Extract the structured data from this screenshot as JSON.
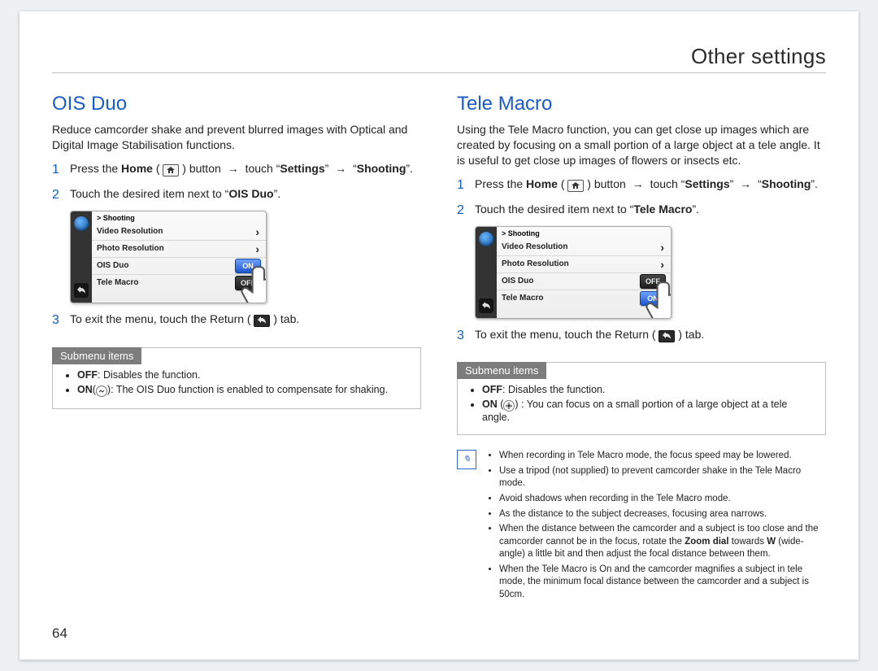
{
  "header": {
    "title": "Other settings"
  },
  "page_number": "64",
  "common": {
    "submenu_label": "Submenu items",
    "step1_prefix": "Press the ",
    "home": "Home",
    "button_word": " button ",
    "touch_word": " touch ",
    "settings": "Settings",
    "shooting": "Shooting",
    "step2_prefix": "Touch the desired item next to ",
    "step3": "To exit the menu, touch the Return (",
    "step3_tail": ") tab."
  },
  "ois": {
    "title": "OIS Duo",
    "blurb": "Reduce camcorder shake and prevent blurred images with Optical and Digital Image Stabilisation functions.",
    "item_name": "OIS Duo",
    "screenshot": {
      "crumb": "> Shooting",
      "items": [
        {
          "label": "Video Resolution",
          "right": "chev"
        },
        {
          "label": "Photo Resolution",
          "right": "chev"
        },
        {
          "label": "OIS Duo",
          "right": "on",
          "pill_on": "ON"
        },
        {
          "label": "Tele Macro",
          "right": "off",
          "pill_off": "OFF"
        }
      ]
    },
    "submenu": {
      "off_label": "OFF",
      "off_text": ": Disables the function.",
      "on_label": "ON",
      "on_text": ": The OIS Duo function is enabled to compensate for shaking."
    }
  },
  "tele": {
    "title": "Tele Macro",
    "blurb": "Using the Tele Macro function, you can get close up images which are created by focusing on a small portion of a large object at a tele angle. It is useful to get close up images of flowers or insects etc.",
    "item_name": "Tele Macro",
    "screenshot": {
      "crumb": "> Shooting",
      "items": [
        {
          "label": "Video Resolution",
          "right": "chev"
        },
        {
          "label": "Photo Resolution",
          "right": "chev"
        },
        {
          "label": "OIS Duo",
          "right": "off",
          "pill_off": "OFF"
        },
        {
          "label": "Tele Macro",
          "right": "on",
          "pill_on": "ON"
        }
      ]
    },
    "submenu": {
      "off_label": "OFF",
      "off_text": ": Disables the function.",
      "on_label": "ON",
      "on_text": ": You can focus on a small portion of a large object at a tele angle."
    },
    "notes": [
      "When recording in Tele Macro mode, the focus speed may be lowered.",
      "Use a tripod (not supplied) to prevent camcorder shake in the Tele Macro mode.",
      "Avoid shadows when recording in the Tele Macro mode.",
      "As the distance to the subject decreases, focusing area narrows.",
      "When the distance between the camcorder and a subject is too close and the camcorder cannot be in the focus, rotate the Zoom dial towards W (wide-angle) a little bit and then adjust the focal distance between them.",
      "When the Tele Macro is On and the camcorder magnifies a subject in tele mode, the minimum focal distance between the camcorder and a subject is 50cm."
    ],
    "zoom_words": {
      "zoom_dial": "Zoom dial",
      "w": "W"
    }
  }
}
